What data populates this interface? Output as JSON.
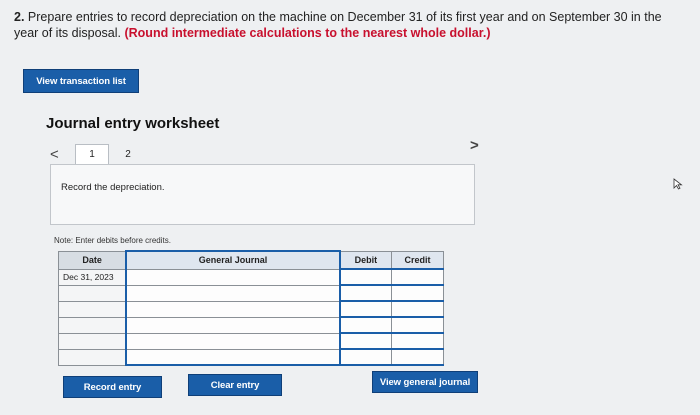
{
  "question": {
    "number": "2.",
    "text": "Prepare entries to record depreciation on the machine on December 31 of its first year and on September 30 in the year of its disposal.",
    "emphasis": "(Round intermediate calculations to the nearest whole dollar.)"
  },
  "buttons": {
    "view_transaction_list": "View transaction list",
    "record_entry": "Record entry",
    "clear_entry": "Clear entry",
    "view_general_journal": "View general journal"
  },
  "worksheet": {
    "title": "Journal entry worksheet",
    "prev_glyph": "<",
    "next_glyph": ">",
    "tabs": [
      "1",
      "2"
    ],
    "description": "Record the depreciation.",
    "note": "Note: Enter debits before credits."
  },
  "table": {
    "headers": {
      "date": "Date",
      "general_journal": "General Journal",
      "debit": "Debit",
      "credit": "Credit"
    },
    "rows": [
      {
        "date": "Dec 31, 2023",
        "account": "",
        "debit": "",
        "credit": ""
      },
      {
        "date": "",
        "account": "",
        "debit": "",
        "credit": ""
      },
      {
        "date": "",
        "account": "",
        "debit": "",
        "credit": ""
      },
      {
        "date": "",
        "account": "",
        "debit": "",
        "credit": ""
      },
      {
        "date": "",
        "account": "",
        "debit": "",
        "credit": ""
      },
      {
        "date": "",
        "account": "",
        "debit": "",
        "credit": ""
      }
    ]
  },
  "colors": {
    "accent": "#1a5ea8",
    "emphasis_red": "#c8102e",
    "background": "#eef0f2"
  }
}
